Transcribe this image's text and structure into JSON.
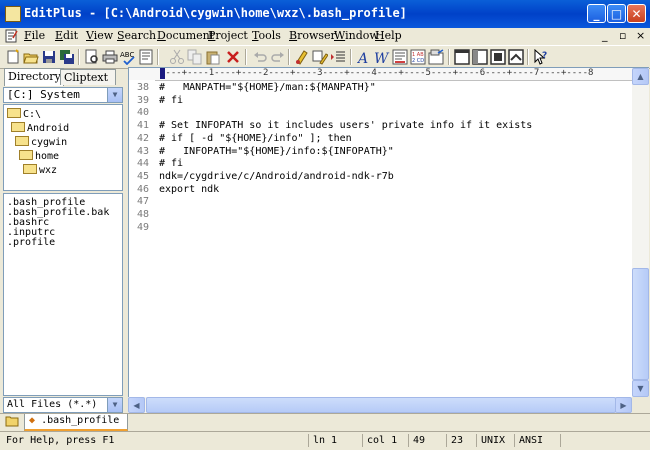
{
  "window": {
    "title": "EditPlus - [C:\\Android\\cygwin\\home\\wxz\\.bash_profile]",
    "minimize_glyph": "_",
    "maximize_glyph": "□",
    "close_glyph": "✕"
  },
  "menubar": {
    "items": [
      "File",
      "Edit",
      "View",
      "Search",
      "Document",
      "Project",
      "Tools",
      "Browser",
      "Window",
      "Help"
    ],
    "mdi_minimize": "_",
    "mdi_restore": "▫",
    "mdi_close": "×"
  },
  "toolbar": {
    "buttons": [
      "new-icon",
      "open-icon",
      "save-icon",
      "save-all-icon",
      "print-preview-icon",
      "print-icon",
      "spellcheck-icon",
      "html-toolbar-icon",
      "cut-icon",
      "copy-icon",
      "paste-icon",
      "delete-icon",
      "undo-icon",
      "redo-icon",
      "find-icon",
      "replace-icon",
      "indent-icon",
      "font-icon",
      "word-wrap-icon",
      "ruler-icon",
      "line-number-icon",
      "output-window-icon",
      "cliptext-icon",
      "directory-window-icon",
      "full-screen-icon",
      "whats-this-icon"
    ]
  },
  "left_panel": {
    "tabs": [
      "Directory",
      "Cliptext"
    ],
    "drive": "[C:] System",
    "tree": [
      "C:\\",
      "Android",
      "cygwin",
      "home",
      "wxz"
    ],
    "files": [
      ".bash_profile",
      ".bash_profile.bak",
      ".bashrc",
      ".inputrc",
      ".profile"
    ],
    "filter": "All Files (*.*)"
  },
  "editor": {
    "ruler": "----+----1----+----2----+----3----+----4----+----5----+----6----+----7----+----8",
    "lines": [
      {
        "n": "38",
        "text": "#   MANPATH=\"${HOME}/man:${MANPATH}\""
      },
      {
        "n": "39",
        "text": "# fi"
      },
      {
        "n": "40",
        "text": ""
      },
      {
        "n": "41",
        "text": "# Set INFOPATH so it includes users' private info if it exists"
      },
      {
        "n": "42",
        "text": "# if [ -d \"${HOME}/info\" ]; then"
      },
      {
        "n": "43",
        "text": "#   INFOPATH=\"${HOME}/info:${INFOPATH}\""
      },
      {
        "n": "44",
        "text": "# fi"
      },
      {
        "n": "45",
        "text": "ndk=/cygdrive/c/Android/android-ndk-r7b"
      },
      {
        "n": "46",
        "text": "export ndk"
      },
      {
        "n": "47",
        "text": ""
      },
      {
        "n": "48",
        "text": ""
      },
      {
        "n": "49",
        "text": ""
      }
    ]
  },
  "doc_tabs": [
    ".bash_profile"
  ],
  "statusbar": {
    "help": "For Help, press F1",
    "line": "ln 1",
    "col": "col 1",
    "total_lines": "49",
    "chars": "23",
    "format": "UNIX",
    "encoding": "ANSI"
  },
  "colors": {
    "title_bar": "#0041c8",
    "chrome": "#ece9d8",
    "line_number": "#7a7a7a"
  }
}
